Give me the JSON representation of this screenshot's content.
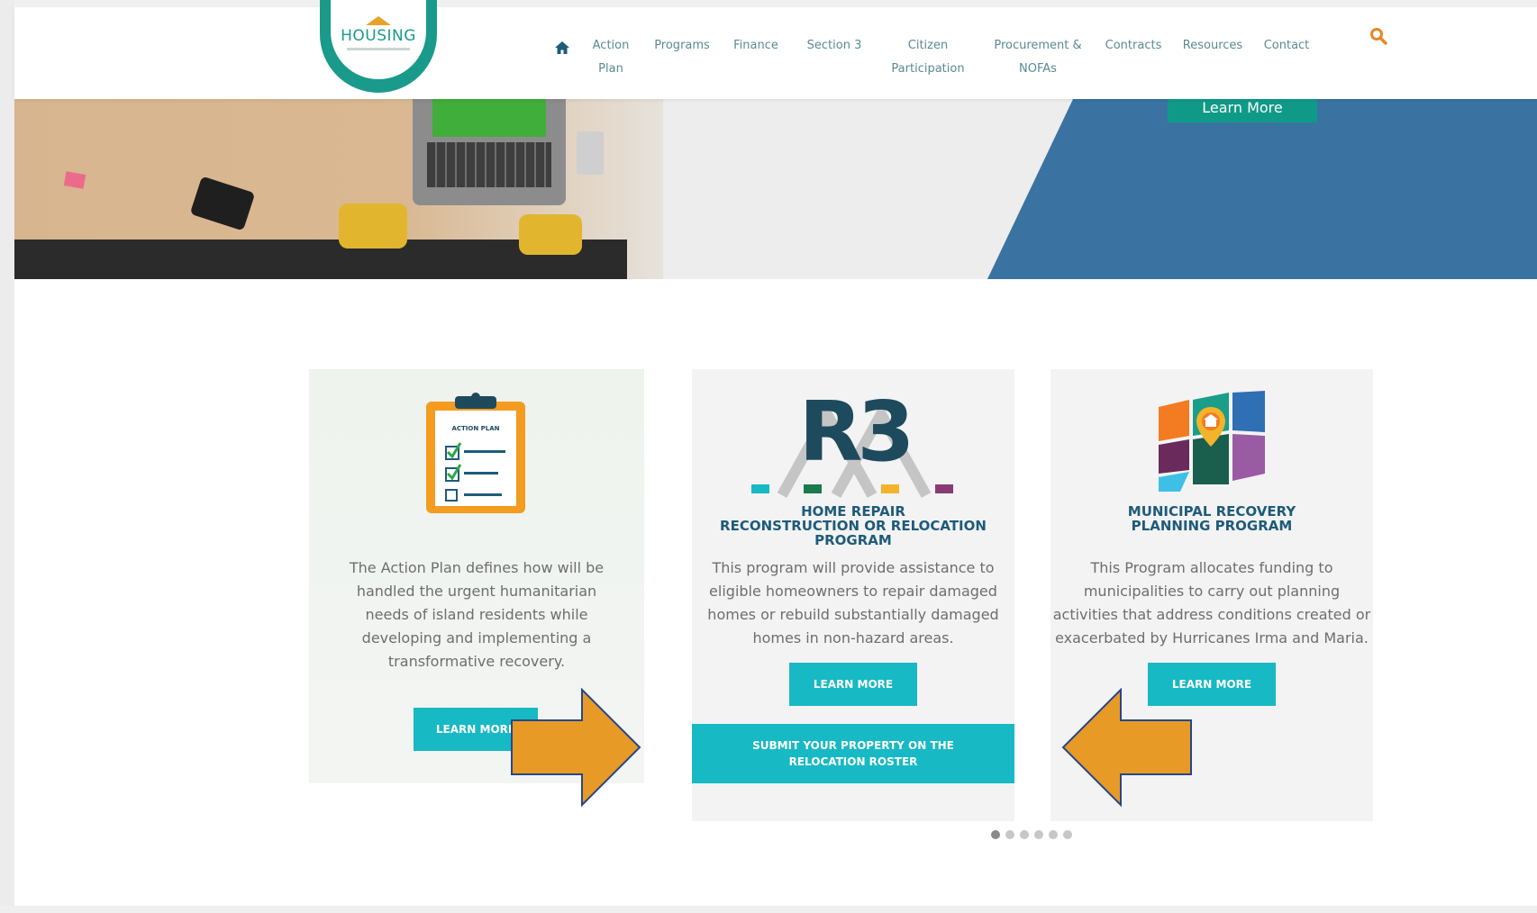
{
  "logo": {
    "text": "HOUSING"
  },
  "nav": {
    "items": [
      {
        "line1": "Action",
        "line2": "Plan"
      },
      {
        "line1": "Programs",
        "line2": ""
      },
      {
        "line1": "Finance",
        "line2": ""
      },
      {
        "line1": "Section 3",
        "line2": ""
      },
      {
        "line1": "Citizen",
        "line2": "Participation"
      },
      {
        "line1": "Procurement &",
        "line2": "NOFAs"
      },
      {
        "line1": "Contracts",
        "line2": ""
      },
      {
        "line1": "Resources",
        "line2": ""
      },
      {
        "line1": "Contact",
        "line2": ""
      }
    ],
    "home_icon": "home-icon",
    "search_icon": "search-icon"
  },
  "hero": {
    "button_label": "Learn More"
  },
  "cards": [
    {
      "icon": "clipboard-checklist-icon",
      "clipboard_label": "ACTION PLAN",
      "title": "",
      "text": "The Action Plan defines how will be handled the urgent humanitarian needs of island residents while developing and implementing a transformative recovery.",
      "button": "LEARN MORE"
    },
    {
      "icon": "r3-logo-icon",
      "logo_text": "R3",
      "title_lines": [
        "HOME REPAIR",
        "RECONSTRUCTION OR RELOCATION",
        "PROGRAM"
      ],
      "text": "This program will provide assistance to eligible homeowners to repair damaged homes or rebuild substantially damaged homes in non-hazard areas.",
      "button": "LEARN MORE",
      "button2_lines": [
        "SUBMIT YOUR PROPERTY ON THE",
        "RELOCATION ROSTER"
      ]
    },
    {
      "icon": "municipal-map-icon",
      "title_lines": [
        "MUNICIPAL RECOVERY",
        "PLANNING PROGRAM"
      ],
      "text": "This Program allocates funding to municipalities to carry out planning activities that address conditions created or exacerbated by Hurricanes Irma and Maria.",
      "button": "LEARN MORE"
    }
  ],
  "carousel": {
    "dot_count": 6,
    "active_index": 0
  },
  "colors": {
    "teal_button": "#17b9c4",
    "nav_text": "#5a8a93",
    "title_blue": "#1e5b7a",
    "hero_blue": "#3a73a1",
    "arrow_orange": "#e89a26",
    "search_orange": "#e8872a"
  }
}
